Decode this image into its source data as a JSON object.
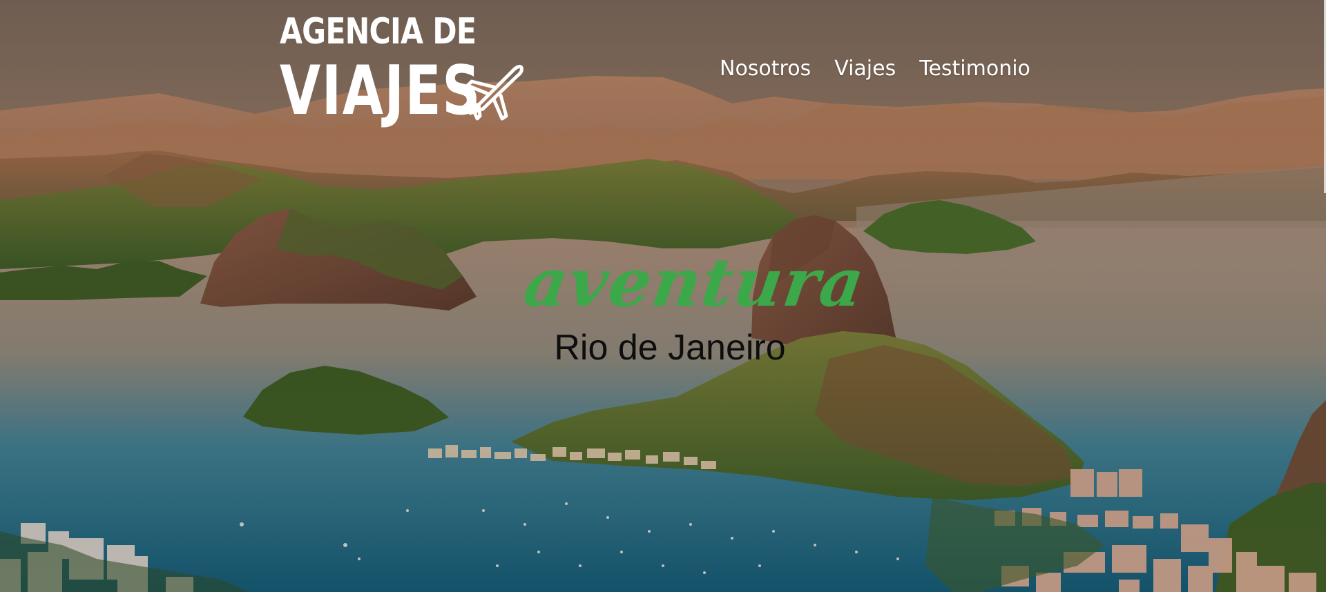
{
  "header": {
    "logo": {
      "line1": "AGENCIA DE",
      "line2": "VIAJES",
      "icon": "airplane-icon"
    },
    "nav": [
      {
        "label": "Nosotros"
      },
      {
        "label": "Viajes"
      },
      {
        "label": "Testimonio"
      }
    ]
  },
  "hero": {
    "tagline": "aventura",
    "subtitle": "Rio de Janeiro",
    "background": "rio-de-janeiro-aerial-photo"
  },
  "colors": {
    "tagline": "#3ca84a",
    "subtitle": "#0e0e0e",
    "nav_text": "#ffffff",
    "sky": "#8a6a50",
    "water": "#1f6d86"
  }
}
